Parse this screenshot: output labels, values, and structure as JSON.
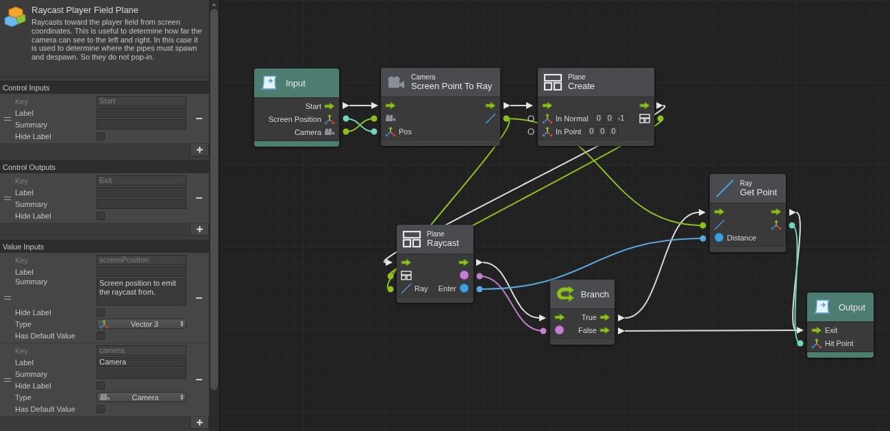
{
  "asset": {
    "title": "Raycast Player Field Plane",
    "description": "Raycasts toward the player field from screen coordinates. This is useful to determine how far the camera can see to the left and right. In this case it is used to determine where the pipes must spawn and despawn. So they do not pop-in."
  },
  "sections": [
    {
      "title": "Control Inputs",
      "items": [
        {
          "fields": [
            {
              "kind": "key",
              "label": "Key",
              "value": "Start"
            },
            {
              "kind": "text",
              "label": "Label"
            },
            {
              "kind": "text",
              "label": "Summary"
            },
            {
              "kind": "checkbox",
              "label": "Hide Label",
              "checked": false
            }
          ]
        }
      ]
    },
    {
      "title": "Control Outputs",
      "items": [
        {
          "fields": [
            {
              "kind": "key",
              "label": "Key",
              "value": "Exit"
            },
            {
              "kind": "text",
              "label": "Label"
            },
            {
              "kind": "text",
              "label": "Summary"
            },
            {
              "kind": "checkbox",
              "label": "Hide Label",
              "checked": false
            }
          ]
        }
      ]
    },
    {
      "title": "Value Inputs",
      "items": [
        {
          "fields": [
            {
              "kind": "key",
              "label": "Key",
              "value": "screenPosition"
            },
            {
              "kind": "text",
              "label": "Label"
            },
            {
              "kind": "textarea",
              "label": "Summary",
              "value": "Screen position to emit the raycast from."
            },
            {
              "kind": "checkbox",
              "label": "Hide Label",
              "checked": false
            },
            {
              "kind": "dropdown",
              "label": "Type",
              "option": {
                "kind": "vector3",
                "label": "Vector 3"
              }
            },
            {
              "kind": "checkbox",
              "label": "Has Default Value",
              "checked": false
            }
          ]
        },
        {
          "fields": [
            {
              "kind": "key",
              "label": "Key",
              "value": "camera"
            },
            {
              "kind": "text",
              "label": "Label",
              "value": "Camera"
            },
            {
              "kind": "text",
              "label": "Summary"
            },
            {
              "kind": "checkbox",
              "label": "Hide Label",
              "checked": false
            },
            {
              "kind": "dropdown",
              "label": "Type",
              "option": {
                "kind": "camera",
                "label": "Camera"
              }
            },
            {
              "kind": "checkbox",
              "label": "Has Default Value",
              "checked": false
            }
          ]
        }
      ]
    }
  ],
  "nodes": [
    {
      "kind": "input",
      "title": "Input",
      "rows": [
        {
          "right": {
            "kind": "control",
            "label": "Start"
          }
        },
        {
          "right": {
            "kind": "vector3",
            "label": "Screen Position"
          }
        },
        {
          "right": {
            "kind": "camera",
            "label": "Camera"
          }
        }
      ]
    },
    {
      "kind": "camera",
      "category": "Camera",
      "title": "Screen Point To Ray",
      "rows": [
        {
          "left": {
            "kind": "control"
          },
          "right": {
            "kind": "control"
          }
        },
        {
          "left": {
            "kind": "camera"
          },
          "right": {
            "kind": "ray"
          }
        },
        {
          "left": {
            "kind": "vector3",
            "label": "Pos"
          }
        }
      ]
    },
    {
      "kind": "plane",
      "category": "Plane",
      "title": "Create",
      "rows": [
        {
          "left": {
            "kind": "control"
          },
          "right": {
            "kind": "control"
          }
        },
        {
          "left": {
            "kind": "vector3",
            "label": "In Normal",
            "defaults": [
              "0",
              "0",
              "-1"
            ]
          },
          "right": {
            "kind": "plane"
          }
        },
        {
          "left": {
            "kind": "vector3",
            "label": "In Point",
            "defaults": [
              "0",
              "0",
              "0"
            ]
          }
        }
      ]
    },
    {
      "kind": "plane",
      "category": "Plane",
      "title": "Raycast",
      "rows": [
        {
          "left": {
            "kind": "control"
          },
          "right": {
            "kind": "control"
          }
        },
        {
          "left": {
            "kind": "plane"
          },
          "right": {
            "kind": "bool"
          }
        },
        {
          "left": {
            "kind": "ray",
            "label": "Ray"
          },
          "right": {
            "kind": "float",
            "label": "Enter"
          }
        }
      ]
    },
    {
      "kind": "branch",
      "title": "Branch",
      "rows": [
        {
          "left": {
            "kind": "control"
          },
          "right": {
            "kind": "control",
            "label": "True"
          }
        },
        {
          "left": {
            "kind": "bool"
          },
          "right": {
            "kind": "control",
            "label": "False"
          }
        }
      ]
    },
    {
      "kind": "ray",
      "category": "Ray",
      "title": "Get Point",
      "rows": [
        {
          "left": {
            "kind": "control"
          },
          "right": {
            "kind": "control"
          }
        },
        {
          "left": {
            "kind": "ray"
          },
          "right": {
            "kind": "vector3"
          }
        },
        {
          "left": {
            "kind": "float",
            "label": "Distance"
          }
        }
      ]
    },
    {
      "kind": "output",
      "title": "Output",
      "rows": [
        {
          "left": {
            "kind": "control",
            "label": "Exit"
          }
        },
        {
          "left": {
            "kind": "vector3",
            "label": "Hit Point"
          }
        }
      ]
    }
  ]
}
